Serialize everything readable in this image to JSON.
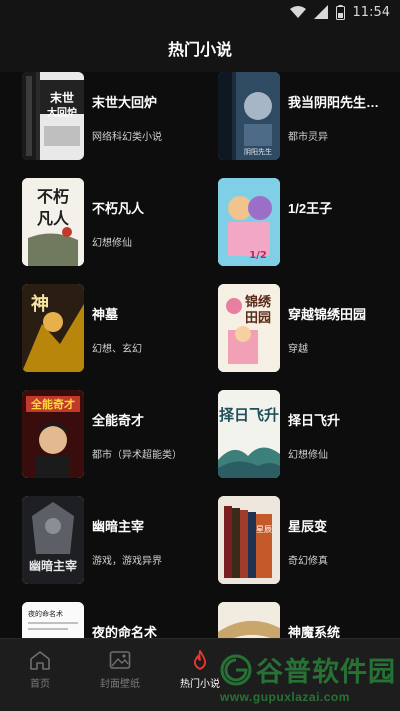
{
  "status_bar": {
    "time": "11:54",
    "icons": [
      "wifi-icon",
      "signal-icon",
      "battery-icon"
    ]
  },
  "header": {
    "title": "热门小说"
  },
  "books": [
    {
      "title": "末世大回炉",
      "genre": "网络科幻类小说",
      "cover_text": "末世大回炉"
    },
    {
      "title": "我当阴阳先生的...",
      "genre": "都市灵异",
      "cover_text": ""
    },
    {
      "title": "不朽凡人",
      "genre": "幻想修仙",
      "cover_text": "不朽凡人"
    },
    {
      "title": "1/2王子",
      "genre": "",
      "cover_text": ""
    },
    {
      "title": "神墓",
      "genre": "幻想、玄幻",
      "cover_text": "神墓"
    },
    {
      "title": "穿越锦绣田园",
      "genre": "穿越",
      "cover_text": "锦绣田园"
    },
    {
      "title": "全能奇才",
      "genre": "都市（异术超能类）",
      "cover_text": "全能奇才"
    },
    {
      "title": "择日飞升",
      "genre": "幻想修仙",
      "cover_text": "择日飞升"
    },
    {
      "title": "幽暗主宰",
      "genre": "游戏，游戏异界",
      "cover_text": "幽暗主宰"
    },
    {
      "title": "星辰变",
      "genre": "奇幻修真",
      "cover_text": ""
    },
    {
      "title": "夜的命名术",
      "genre": "",
      "cover_text": "夜的命名术"
    },
    {
      "title": "神魔系统",
      "genre": "",
      "cover_text": ""
    }
  ],
  "nav": [
    {
      "label": "首页",
      "icon": "home-icon"
    },
    {
      "label": "封面壁纸",
      "icon": "image-icon"
    },
    {
      "label": "热门小说",
      "icon": "flame-icon",
      "active": true
    }
  ],
  "watermark": {
    "main": "谷普软件园",
    "url": "www.gupuxlazai.com"
  },
  "colors": {
    "background": "#0d0d0d",
    "accent": "#e8382f",
    "watermark": "#2fb84a"
  }
}
